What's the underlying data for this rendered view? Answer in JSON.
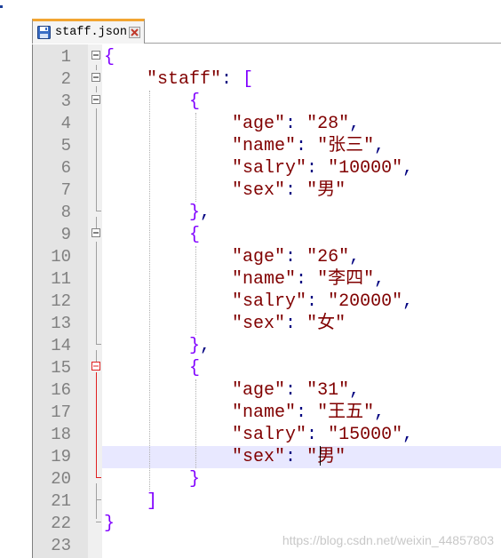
{
  "tab": {
    "filename": "staff.json",
    "icon": "save-disk-icon",
    "close_icon": "close-icon",
    "accent_color": "#f2a531"
  },
  "editor": {
    "current_line": 19,
    "lines": [
      {
        "n": "1",
        "segments": [
          [
            "brace",
            "{"
          ]
        ]
      },
      {
        "n": "2",
        "segments": [
          [
            "text",
            "    "
          ],
          [
            "key",
            "\"staff\""
          ],
          [
            "punct",
            ": "
          ],
          [
            "brace",
            "["
          ]
        ]
      },
      {
        "n": "3",
        "segments": [
          [
            "text",
            "        "
          ],
          [
            "brace",
            "{"
          ]
        ]
      },
      {
        "n": "4",
        "segments": [
          [
            "text",
            "            "
          ],
          [
            "key",
            "\"age\""
          ],
          [
            "punct",
            ": "
          ],
          [
            "str",
            "\"28\""
          ],
          [
            "punct",
            ","
          ]
        ]
      },
      {
        "n": "5",
        "segments": [
          [
            "text",
            "            "
          ],
          [
            "key",
            "\"name\""
          ],
          [
            "punct",
            ": "
          ],
          [
            "str",
            "\"张三\""
          ],
          [
            "punct",
            ","
          ]
        ]
      },
      {
        "n": "6",
        "segments": [
          [
            "text",
            "            "
          ],
          [
            "key",
            "\"salry\""
          ],
          [
            "punct",
            ": "
          ],
          [
            "str",
            "\"10000\""
          ],
          [
            "punct",
            ","
          ]
        ]
      },
      {
        "n": "7",
        "segments": [
          [
            "text",
            "            "
          ],
          [
            "key",
            "\"sex\""
          ],
          [
            "punct",
            ": "
          ],
          [
            "str",
            "\"男\""
          ]
        ]
      },
      {
        "n": "8",
        "segments": [
          [
            "text",
            "        "
          ],
          [
            "brace",
            "}"
          ],
          [
            "punct",
            ","
          ]
        ]
      },
      {
        "n": "9",
        "segments": [
          [
            "text",
            "        "
          ],
          [
            "brace",
            "{"
          ]
        ]
      },
      {
        "n": "10",
        "segments": [
          [
            "text",
            "            "
          ],
          [
            "key",
            "\"age\""
          ],
          [
            "punct",
            ": "
          ],
          [
            "str",
            "\"26\""
          ],
          [
            "punct",
            ","
          ]
        ]
      },
      {
        "n": "11",
        "segments": [
          [
            "text",
            "            "
          ],
          [
            "key",
            "\"name\""
          ],
          [
            "punct",
            ": "
          ],
          [
            "str",
            "\"李四\""
          ],
          [
            "punct",
            ","
          ]
        ]
      },
      {
        "n": "12",
        "segments": [
          [
            "text",
            "            "
          ],
          [
            "key",
            "\"salry\""
          ],
          [
            "punct",
            ": "
          ],
          [
            "str",
            "\"20000\""
          ],
          [
            "punct",
            ","
          ]
        ]
      },
      {
        "n": "13",
        "segments": [
          [
            "text",
            "            "
          ],
          [
            "key",
            "\"sex\""
          ],
          [
            "punct",
            ": "
          ],
          [
            "str",
            "\"女\""
          ]
        ]
      },
      {
        "n": "14",
        "segments": [
          [
            "text",
            "        "
          ],
          [
            "brace",
            "}"
          ],
          [
            "punct",
            ","
          ]
        ]
      },
      {
        "n": "15",
        "segments": [
          [
            "text",
            "        "
          ],
          [
            "brace",
            "{"
          ]
        ]
      },
      {
        "n": "16",
        "segments": [
          [
            "text",
            "            "
          ],
          [
            "key",
            "\"age\""
          ],
          [
            "punct",
            ": "
          ],
          [
            "str",
            "\"31\""
          ],
          [
            "punct",
            ","
          ]
        ]
      },
      {
        "n": "17",
        "segments": [
          [
            "text",
            "            "
          ],
          [
            "key",
            "\"name\""
          ],
          [
            "punct",
            ": "
          ],
          [
            "str",
            "\"王五\""
          ],
          [
            "punct",
            ","
          ]
        ]
      },
      {
        "n": "18",
        "segments": [
          [
            "text",
            "            "
          ],
          [
            "key",
            "\"salry\""
          ],
          [
            "punct",
            ": "
          ],
          [
            "str",
            "\"15000\""
          ],
          [
            "punct",
            ","
          ]
        ]
      },
      {
        "n": "19",
        "segments": [
          [
            "text",
            "            "
          ],
          [
            "key",
            "\"sex\""
          ],
          [
            "punct",
            ": "
          ],
          [
            "str",
            "\"男\""
          ]
        ]
      },
      {
        "n": "20",
        "segments": [
          [
            "text",
            "        "
          ],
          [
            "brace",
            "}"
          ]
        ]
      },
      {
        "n": "21",
        "segments": [
          [
            "text",
            "    "
          ],
          [
            "brace",
            "]"
          ]
        ]
      },
      {
        "n": "22",
        "segments": [
          [
            "brace",
            "}"
          ]
        ]
      },
      {
        "n": "23",
        "segments": []
      }
    ],
    "colors": {
      "brace": "#8000ff",
      "key": "#800000",
      "string": "#800000",
      "punct": "#000080",
      "line_number": "#808080",
      "current_line_bg": "#e8e8ff",
      "gutter_bg": "#e4e4e4"
    }
  },
  "watermark": "https://blog.csdn.net/weixin_44857803"
}
